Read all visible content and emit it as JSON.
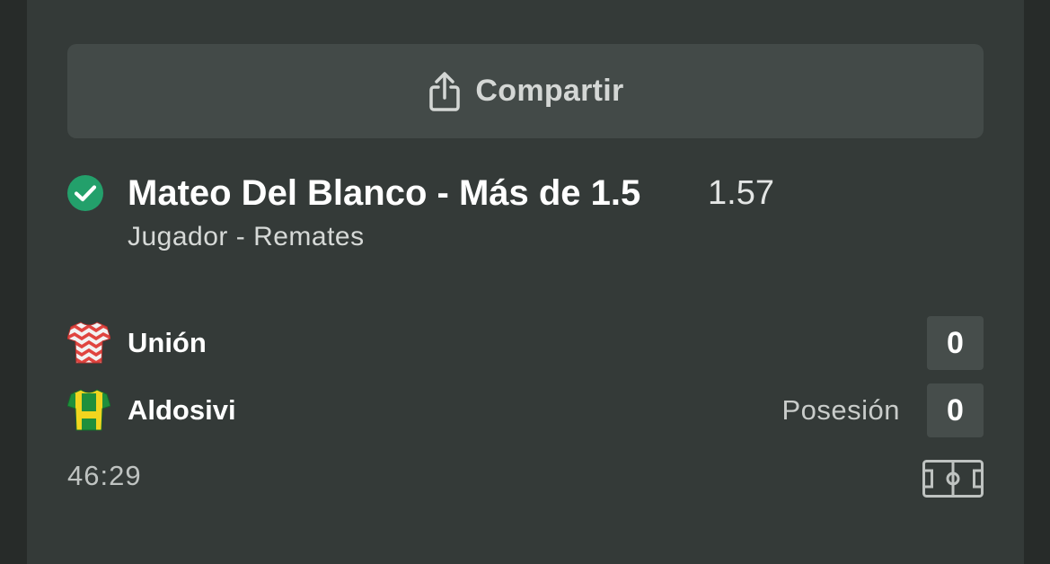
{
  "share": {
    "label": "Compartir",
    "icon": "share-icon"
  },
  "bet": {
    "status_icon": "check-circle-icon",
    "status_color": "#23a06b",
    "selection": "Mateo Del Blanco - Más de 1.5",
    "odds": "1.57",
    "market": "Jugador - Remates"
  },
  "match": {
    "teams": [
      {
        "name": "Unión",
        "score": "0",
        "stat_label": "",
        "jersey_icon": "red-white-striped-jersey-icon"
      },
      {
        "name": "Aldosivi",
        "score": "0",
        "stat_label": "Posesión",
        "jersey_icon": "green-yellow-jersey-icon"
      }
    ],
    "time": "46:29",
    "field_icon": "soccer-pitch-icon"
  }
}
